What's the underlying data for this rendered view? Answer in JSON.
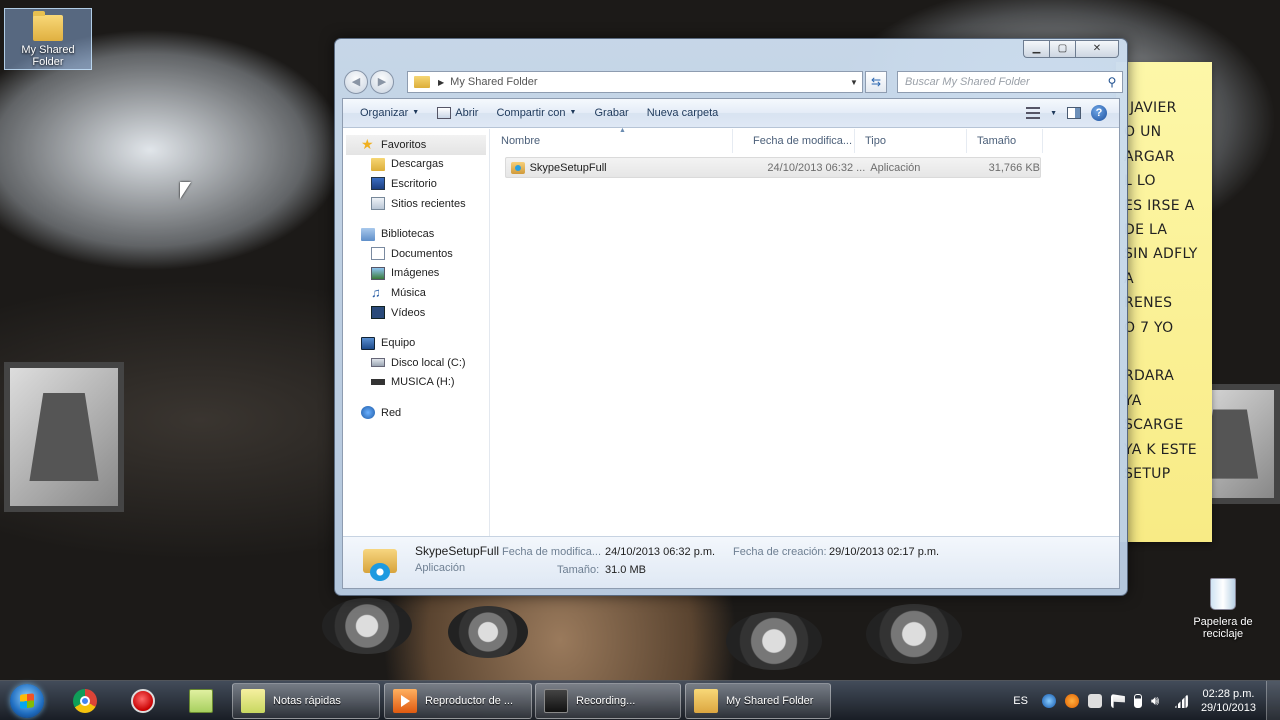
{
  "desktop": {
    "icons": [
      {
        "label": "My Shared Folder",
        "icon": "folder-icon"
      },
      {
        "label_line1": "Papelera de",
        "label_line2": "reciclaje",
        "icon": "recycle-bin-icon"
      }
    ]
  },
  "sticky_note": {
    "lines": [
      "JAVIER",
      "O UN",
      "ARGAR",
      "L LO",
      "ES IRSE A",
      "DE LA",
      "SIN ADFLY",
      "A",
      "RENES",
      "O 7 YO",
      "",
      "RDARA",
      "YA",
      "SCARGE",
      "YA K ESTE",
      "SETUP"
    ]
  },
  "window": {
    "address": {
      "path": "My Shared Folder"
    },
    "search": {
      "placeholder": "Buscar My Shared Folder"
    },
    "toolbar": {
      "organize": "Organizar",
      "open": "Abrir",
      "share": "Compartir con",
      "burn": "Grabar",
      "new_folder": "Nueva carpeta"
    },
    "nav": {
      "favorites": "Favoritos",
      "downloads": "Descargas",
      "desktop": "Escritorio",
      "recent": "Sitios recientes",
      "libraries": "Bibliotecas",
      "documents": "Documentos",
      "images": "Imágenes",
      "music": "Música",
      "videos": "Vídeos",
      "computer": "Equipo",
      "local_disk": "Disco local (C:)",
      "musica_drive": "MUSICA (H:)",
      "network": "Red"
    },
    "columns": {
      "name": "Nombre",
      "date": "Fecha de modifica...",
      "type": "Tipo",
      "size": "Tamaño"
    },
    "files": [
      {
        "name": "SkypeSetupFull",
        "date": "24/10/2013 06:32 ...",
        "type": "Aplicación",
        "size": "31,766 KB"
      }
    ],
    "details": {
      "name": "SkypeSetupFull",
      "type": "Aplicación",
      "modified_label": "Fecha de modifica...",
      "modified_value": "24/10/2013 06:32 p.m.",
      "size_label": "Tamaño:",
      "size_value": "31.0 MB",
      "created_label": "Fecha de creación:",
      "created_value": "29/10/2013 02:17 p.m."
    }
  },
  "taskbar": {
    "tasks": {
      "notes": "Notas rápidas",
      "player": "Reproductor de ...",
      "recording": "Recording...",
      "folder": "My Shared Folder"
    },
    "language": "ES",
    "time": "02:28 p.m.",
    "date": "29/10/2013"
  }
}
